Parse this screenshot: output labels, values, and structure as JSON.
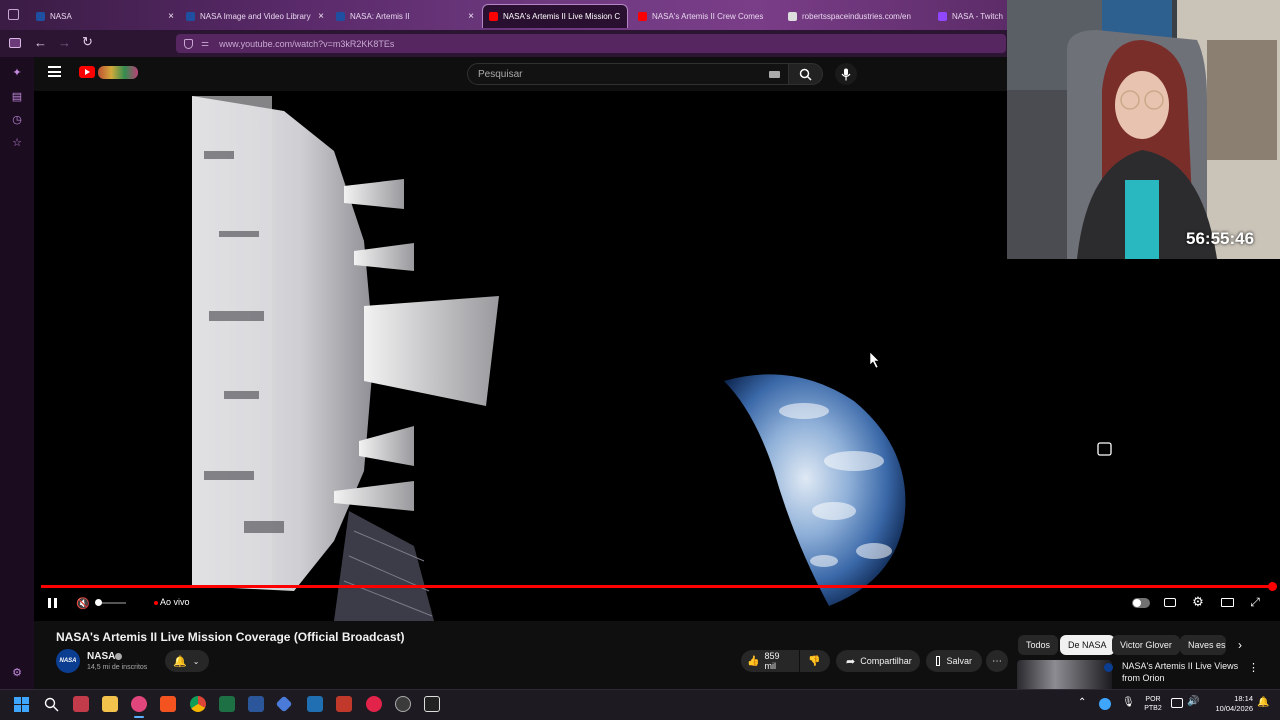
{
  "browser": {
    "tabs": [
      {
        "label": "NASA",
        "color": "#1f4fa0"
      },
      {
        "label": "NASA Image and Video Library",
        "color": "#1f4fa0"
      },
      {
        "label": "NASA: Artemis II",
        "color": "#1f4fa0"
      },
      {
        "label": "NASA's Artemis II Live Mission C",
        "color": "#ff0000",
        "active": true
      },
      {
        "label": "NASA's Artemis II Crew Comes",
        "color": "#ff0000"
      },
      {
        "label": "robertsspaceindustries.com/en",
        "color": "#dddddd"
      },
      {
        "label": "NASA - Twitch",
        "color": "#9146ff"
      }
    ],
    "url": "www.youtube.com/watch?v=m3kR2KK8TEs"
  },
  "youtube": {
    "search_placeholder": "Pesquisar",
    "live_label": "Ao vivo",
    "video_title": "NASA's Artemis II Live Mission Coverage (Official Broadcast)",
    "channel": {
      "name": "NASA",
      "subscribers": "14,5 mi de inscritos",
      "avatar_text": "NASA"
    },
    "actions": {
      "likes": "859 mil",
      "share": "Compartilhar",
      "save": "Salvar"
    },
    "chips": [
      "Todos",
      "De NASA",
      "Victor Glover",
      "Naves esp"
    ],
    "active_chip_index": 1,
    "recommendation": {
      "title_line1": "NASA's Artemis II Live Views",
      "title_line2": "from Orion"
    },
    "progress_fraction": 1.0
  },
  "webcam": {
    "timer": "56:55:46"
  },
  "taskbar": {
    "lang_line1": "POR",
    "lang_line2": "PTB2",
    "time": "18:14",
    "date": "10/04/2026"
  },
  "colors": {
    "accent": "#ff0000",
    "browser_theme": "#5a2a6a"
  }
}
